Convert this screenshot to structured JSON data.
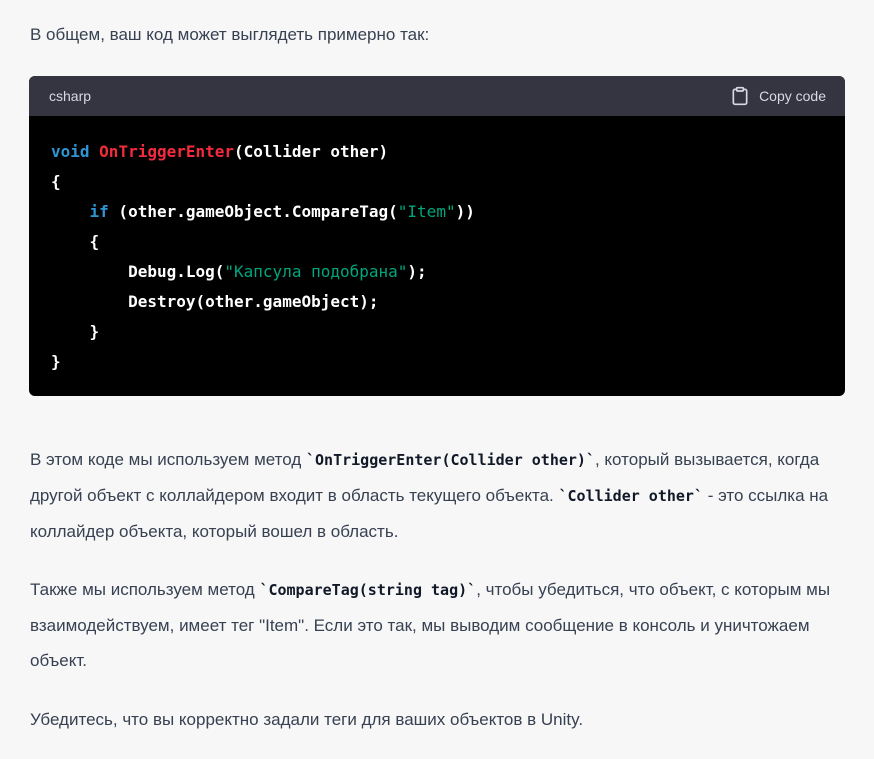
{
  "intro_text": "В общем, ваш код может выглядеть примерно так:",
  "code_block": {
    "language": "csharp",
    "copy_label": "Copy code",
    "copy_icon": "clipboard-icon",
    "colors": {
      "header_bg": "#343541",
      "body_bg": "#000000",
      "keyword": "#2e95d3",
      "function": "#f22c3d",
      "string": "#00a67d"
    },
    "lines": {
      "l1": {
        "kw": "void",
        "sp": " ",
        "fn": "OnTriggerEnter",
        "rest": "(Collider other)"
      },
      "l2": {
        "text": "{"
      },
      "l3": {
        "indent": "    ",
        "kw": "if",
        "pre": " (other.gameObject.CompareTag(",
        "str": "\"Item\"",
        "post": "))"
      },
      "l4": {
        "text": "    {"
      },
      "l5": {
        "pre": "        Debug.Log(",
        "str": "\"Капсула подобрана\"",
        "post": ");"
      },
      "l6": {
        "text": "        Destroy(other.gameObject);"
      },
      "l7": {
        "text": "    }"
      },
      "l8": {
        "text": "}"
      }
    }
  },
  "paragraphs": {
    "p1": {
      "t1": "В этом коде мы используем метод ",
      "c1": "`OnTriggerEnter(Collider other)`",
      "t2": ", который вызывается, когда другой объект с коллайдером входит в область текущего объекта. ",
      "c2": "`Collider other`",
      "t3": " - это ссылка на коллайдер объекта, который вошел в область."
    },
    "p2": {
      "t1": "Также мы используем метод ",
      "c1": "`CompareTag(string tag)`",
      "t2": ", чтобы убедиться, что объект, с которым мы взаимодействуем, имеет тег \"Item\". Если это так, мы выводим сообщение в консоль и уничтожаем объект."
    },
    "p3": {
      "t1": "Убедитесь, что вы корректно задали теги для ваших объектов в Unity."
    }
  }
}
